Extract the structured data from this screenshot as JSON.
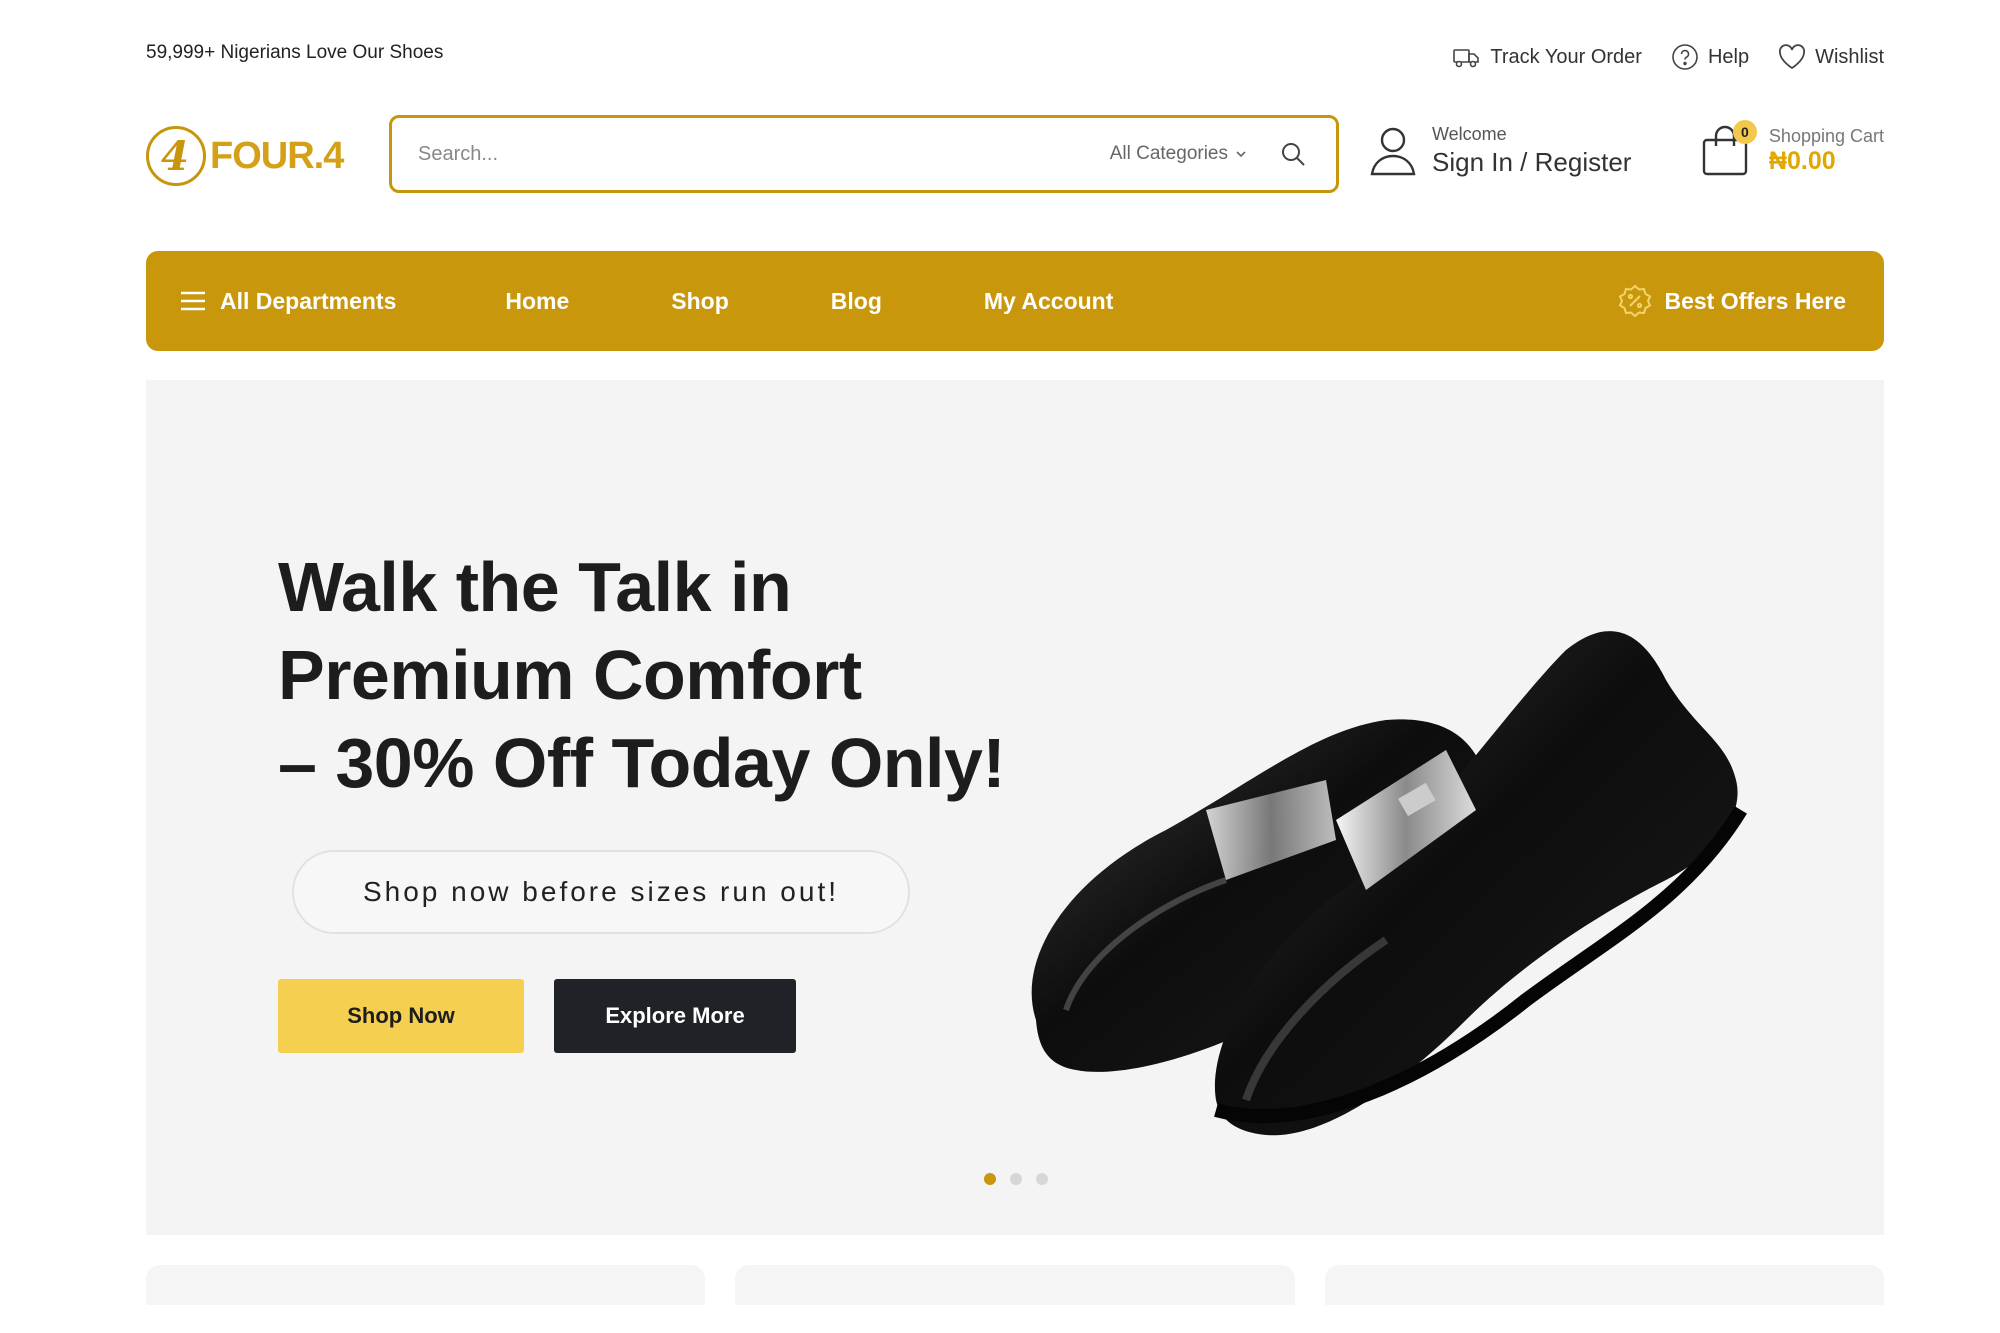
{
  "topbar": {
    "tagline": "59,999+ Nigerians Love Our Shoes",
    "links": [
      {
        "label": "Track Your Order",
        "icon": "truck-icon"
      },
      {
        "label": "Help",
        "icon": "help-icon"
      },
      {
        "label": "Wishlist",
        "icon": "heart-icon"
      }
    ]
  },
  "header": {
    "logo_text": "FOUR.4",
    "logo_mark": "4",
    "search": {
      "placeholder": "Search...",
      "category": "All Categories"
    },
    "account": {
      "welcome": "Welcome",
      "action": "Sign In / Register"
    },
    "cart": {
      "count": "0",
      "label": "Shopping Cart",
      "amount": "₦0.00"
    }
  },
  "nav": {
    "departments": "All Departments",
    "items": [
      "Home",
      "Shop",
      "Blog",
      "My Account"
    ],
    "offers": "Best Offers Here"
  },
  "hero": {
    "headline": [
      "Walk the Talk in",
      "Premium Comfort",
      "– 30% Off Today Only!"
    ],
    "subtitle": "Shop now before sizes run out!",
    "primary_button": "Shop Now",
    "secondary_button": "Explore More",
    "slides": 3,
    "active_slide": 1
  },
  "colors": {
    "brand": "#c9970c",
    "accent_yellow": "#f5cf4f",
    "dark": "#1f2328",
    "hero_bg": "#f4f4f4"
  }
}
